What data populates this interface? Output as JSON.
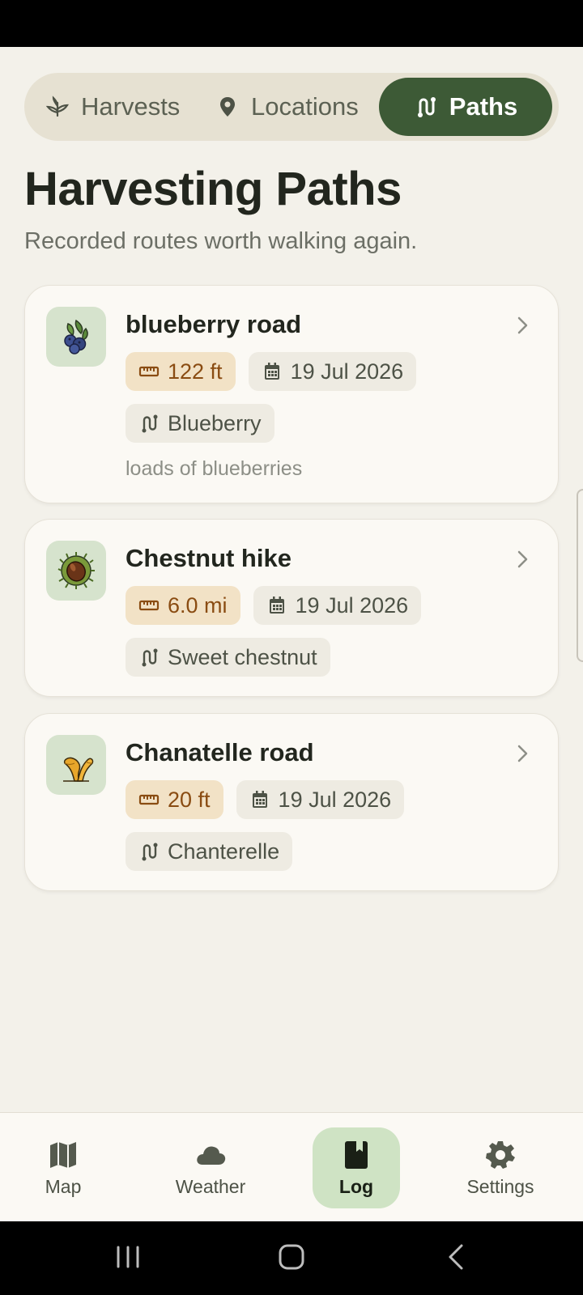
{
  "segments": {
    "harvests": "Harvests",
    "locations": "Locations",
    "paths": "Paths"
  },
  "page": {
    "title": "Harvesting Paths",
    "subtitle": "Recorded routes worth walking again."
  },
  "paths": [
    {
      "title": "blueberry road",
      "distance": "122 ft",
      "date": "19 Jul 2026",
      "species": "Blueberry",
      "note": "loads of blueberries",
      "icon": "blueberry-icon"
    },
    {
      "title": "Chestnut hike",
      "distance": "6.0 mi",
      "date": "19 Jul 2026",
      "species": "Sweet chestnut",
      "icon": "chestnut-icon"
    },
    {
      "title": "Chanatelle road",
      "distance": "20 ft",
      "date": "19 Jul 2026",
      "species": "Chanterelle",
      "icon": "chanterelle-icon"
    }
  ],
  "nav": {
    "map": "Map",
    "weather": "Weather",
    "log": "Log",
    "settings": "Settings"
  },
  "colors": {
    "accent": "#3d5a36",
    "background": "#f3f1ea",
    "card": "#fbf9f4",
    "distance_chip": "#f2e2c6",
    "active_nav": "#cfe3c4"
  }
}
